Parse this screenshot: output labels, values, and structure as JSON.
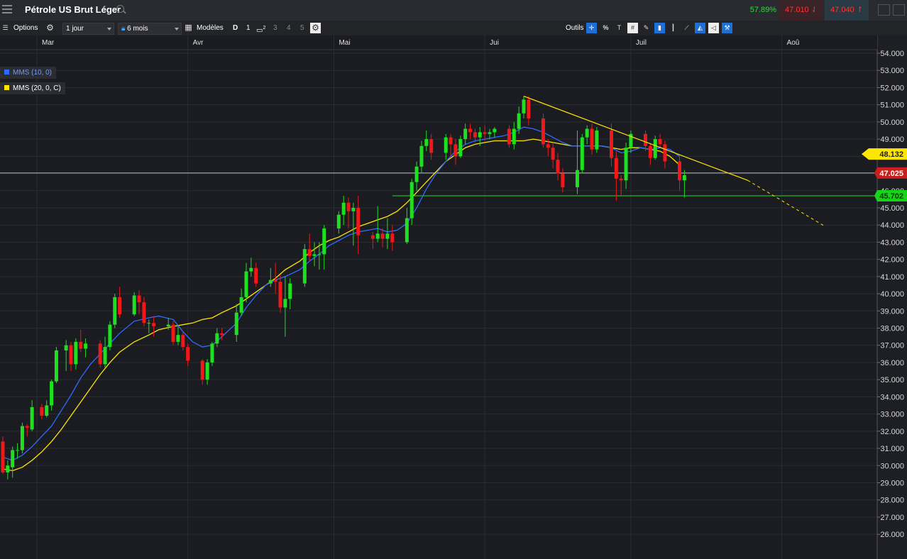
{
  "header": {
    "title": "Pétrole US Brut Léger",
    "change_pct": "57.89%",
    "sell_price": "47.010",
    "buy_price": "47.040"
  },
  "toolbar": {
    "options": "Options",
    "interval": "1 jour",
    "range": "6 mois",
    "models": "Modèles",
    "d": "D",
    "n1": "1",
    "n2": "2",
    "n3": "3",
    "n4": "4",
    "n5": "5",
    "tools": "Outils",
    "pct": "%"
  },
  "legend": {
    "ma10": "MMS (10, 0)",
    "ma20": "MMS (20, 0, C)",
    "ma10_color": "#2f6bff",
    "ma20_color": "#ffe600"
  },
  "chart_data": {
    "type": "candlestick",
    "months": [
      {
        "label": "Mar",
        "day": 0
      },
      {
        "label": "Avr",
        "day": 31
      },
      {
        "label": "Mai",
        "day": 61
      },
      {
        "label": "Jui",
        "day": 92
      },
      {
        "label": "Juil",
        "day": 122
      },
      {
        "label": "Aoû",
        "day": 153
      }
    ],
    "y_ticks": [
      "54.000",
      "53.000",
      "52.000",
      "51.000",
      "50.000",
      "49.000",
      "48.000",
      "47.000",
      "46.000",
      "45.000",
      "44.000",
      "43.000",
      "42.000",
      "41.000",
      "40.000",
      "39.000",
      "38.000",
      "37.000",
      "36.000",
      "35.000",
      "34.000",
      "33.000",
      "32.000",
      "31.000",
      "30.000",
      "29.000",
      "28.000",
      "27.000",
      "26.000"
    ],
    "ylim": [
      25.3,
      54.2
    ],
    "candles": [
      [
        -7,
        31.4,
        29.6,
        31.7,
        29.5
      ],
      [
        -6,
        29.6,
        30.0,
        30.3,
        29.2
      ],
      [
        -5,
        29.9,
        30.9,
        31.1,
        29.3
      ],
      [
        -4,
        30.9,
        30.9,
        31.3,
        30.4
      ],
      [
        -3,
        30.9,
        32.3,
        32.5,
        30.7
      ],
      [
        -2,
        32.3,
        32.2,
        32.4,
        31.7
      ],
      [
        -1,
        32.1,
        33.4,
        33.8,
        32.0
      ],
      [
        1,
        33.4,
        32.9,
        33.6,
        32.7
      ],
      [
        2,
        32.9,
        33.5,
        33.8,
        32.8
      ],
      [
        3,
        33.5,
        34.9,
        35.0,
        33.2
      ],
      [
        4,
        34.9,
        36.7,
        36.9,
        34.8
      ],
      [
        6,
        36.7,
        37.0,
        37.3,
        35.5
      ],
      [
        7,
        37.0,
        35.9,
        37.2,
        35.5
      ],
      [
        8,
        35.9,
        37.2,
        37.4,
        35.6
      ],
      [
        9,
        37.2,
        36.8,
        37.9,
        36.6
      ],
      [
        10,
        36.8,
        37.1,
        37.4,
        36.3
      ],
      [
        13,
        37.1,
        35.9,
        37.3,
        35.7
      ],
      [
        14,
        35.9,
        36.9,
        37.5,
        35.7
      ],
      [
        15,
        36.9,
        38.2,
        38.4,
        36.7
      ],
      [
        16,
        38.2,
        39.8,
        40.0,
        38.0
      ],
      [
        17,
        39.8,
        38.8,
        40.4,
        38.6
      ],
      [
        20,
        38.8,
        39.9,
        40.1,
        38.7
      ],
      [
        21,
        39.9,
        39.5,
        40.2,
        38.8
      ],
      [
        22,
        39.5,
        38.3,
        39.8,
        38.1
      ],
      [
        23,
        38.3,
        38.3,
        38.5,
        37.7
      ],
      [
        24,
        38.3,
        38.1,
        38.7,
        37.5
      ],
      [
        27,
        38.1,
        38.2,
        38.6,
        37.9
      ],
      [
        28,
        38.2,
        37.2,
        38.4,
        37.0
      ],
      [
        29,
        37.2,
        37.6,
        38.1,
        37.0
      ],
      [
        30,
        37.6,
        36.9,
        37.8,
        36.7
      ],
      [
        31,
        36.9,
        36.1,
        37.1,
        35.8
      ],
      [
        34,
        36.1,
        35.0,
        36.2,
        34.7
      ],
      [
        35,
        35.0,
        36.0,
        36.2,
        34.7
      ],
      [
        36,
        36.0,
        37.1,
        37.2,
        35.8
      ],
      [
        37,
        37.1,
        37.7,
        38.0,
        36.9
      ],
      [
        38,
        37.7,
        37.6,
        38.0,
        37.3
      ],
      [
        41,
        37.6,
        38.9,
        39.4,
        37.2
      ],
      [
        42,
        38.9,
        39.8,
        40.3,
        38.7
      ],
      [
        43,
        39.8,
        41.3,
        41.8,
        39.5
      ],
      [
        44,
        41.3,
        41.5,
        42.1,
        41.0
      ],
      [
        45,
        41.5,
        40.6,
        41.8,
        40.4
      ],
      [
        48,
        40.6,
        40.8,
        41.5,
        40.4
      ],
      [
        49,
        40.8,
        40.7,
        41.8,
        40.0
      ],
      [
        50,
        40.7,
        39.2,
        41.1,
        38.9
      ],
      [
        51,
        39.2,
        39.7,
        41.0,
        37.5
      ],
      [
        52,
        39.7,
        40.6,
        40.9,
        39.1
      ],
      [
        55,
        40.6,
        42.6,
        42.9,
        40.4
      ],
      [
        56,
        42.6,
        42.2,
        43.5,
        41.9
      ],
      [
        57,
        42.2,
        42.3,
        43.0,
        41.6
      ],
      [
        58,
        42.3,
        42.3,
        43.0,
        41.4
      ],
      [
        59,
        42.3,
        43.8,
        44.0,
        41.4
      ],
      [
        62,
        43.8,
        44.6,
        44.8,
        43.5
      ],
      [
        63,
        44.6,
        45.3,
        45.7,
        44.0
      ],
      [
        64,
        45.3,
        44.8,
        45.6,
        43.8
      ],
      [
        65,
        44.8,
        45.0,
        45.3,
        42.8
      ],
      [
        66,
        45.0,
        43.4,
        45.7,
        42.3
      ],
      [
        69,
        43.4,
        43.2,
        43.6,
        42.6
      ],
      [
        70,
        43.2,
        43.5,
        45.1,
        43.0
      ],
      [
        71,
        43.5,
        43.2,
        43.8,
        42.7
      ],
      [
        72,
        43.2,
        43.5,
        44.4,
        42.6
      ],
      [
        73,
        43.5,
        43.0,
        44.0,
        42.5
      ],
      [
        76,
        43.0,
        44.4,
        45.0,
        42.9
      ],
      [
        77,
        44.4,
        46.5,
        46.7,
        44.0
      ],
      [
        78,
        46.5,
        47.4,
        47.7,
        46.0
      ],
      [
        79,
        47.4,
        48.6,
        48.9,
        47.0
      ],
      [
        80,
        48.6,
        49.0,
        49.5,
        48.3
      ],
      [
        81,
        49.0,
        48.2,
        49.3,
        47.8
      ],
      [
        84,
        48.2,
        49.1,
        49.3,
        47.8
      ],
      [
        85,
        49.1,
        48.7,
        49.3,
        48.0
      ],
      [
        86,
        48.7,
        48.0,
        49.0,
        47.5
      ],
      [
        87,
        48.0,
        49.0,
        49.2,
        47.9
      ],
      [
        88,
        49.0,
        49.6,
        49.9,
        48.7
      ],
      [
        89,
        49.6,
        49.4,
        49.9,
        49.0
      ],
      [
        90,
        49.4,
        49.1,
        49.6,
        48.8
      ],
      [
        91,
        49.1,
        49.4,
        49.7,
        48.6
      ],
      [
        92,
        49.4,
        49.3,
        49.8,
        48.9
      ],
      [
        93,
        49.3,
        49.4,
        49.6,
        49.0
      ],
      [
        94,
        49.4,
        49.6,
        49.7,
        49.1
      ],
      [
        97,
        49.6,
        48.7,
        49.8,
        48.5
      ],
      [
        98,
        48.7,
        49.6,
        50.0,
        48.4
      ],
      [
        99,
        49.6,
        50.5,
        50.9,
        49.3
      ],
      [
        100,
        50.5,
        51.3,
        51.5,
        50.2
      ],
      [
        101,
        51.3,
        50.2,
        51.5,
        49.8
      ],
      [
        104,
        50.2,
        48.7,
        50.5,
        48.5
      ],
      [
        105,
        48.7,
        48.5,
        49.0,
        48.0
      ],
      [
        106,
        48.5,
        47.8,
        48.8,
        47.3
      ],
      [
        107,
        47.8,
        47.0,
        48.2,
        46.6
      ],
      [
        108,
        47.0,
        46.2,
        47.3,
        45.9
      ],
      [
        111,
        46.2,
        47.2,
        49.5,
        45.8
      ],
      [
        112,
        47.2,
        49.1,
        49.3,
        47.0
      ],
      [
        113,
        49.1,
        49.6,
        49.8,
        48.7
      ],
      [
        114,
        49.6,
        48.4,
        49.9,
        48.1
      ],
      [
        115,
        48.4,
        49.5,
        49.7,
        48.2
      ],
      [
        118,
        49.5,
        47.9,
        49.9,
        47.4
      ],
      [
        119,
        47.9,
        46.7,
        48.3,
        45.4
      ],
      [
        120,
        46.7,
        46.6,
        46.9,
        45.7
      ],
      [
        121,
        46.6,
        48.5,
        48.8,
        46.1
      ],
      [
        122,
        48.5,
        49.3,
        49.5,
        48.2
      ],
      [
        125,
        49.3,
        48.6,
        49.5,
        48.3
      ],
      [
        126,
        48.6,
        47.9,
        48.8,
        47.5
      ],
      [
        127,
        47.9,
        49.0,
        49.2,
        47.8
      ],
      [
        128,
        49.0,
        48.7,
        49.3,
        48.5
      ],
      [
        129,
        48.7,
        47.7,
        48.9,
        47.3
      ],
      [
        132,
        47.7,
        46.6,
        48.0,
        46.0
      ],
      [
        133,
        46.6,
        46.9,
        47.2,
        45.6
      ]
    ],
    "ma10": [
      [
        -7,
        30.5
      ],
      [
        -5,
        30.3
      ],
      [
        -3,
        30.6
      ],
      [
        -1,
        31.1
      ],
      [
        1,
        31.7
      ],
      [
        3,
        32.3
      ],
      [
        5,
        33.2
      ],
      [
        7,
        34.1
      ],
      [
        9,
        35.1
      ],
      [
        11,
        35.9
      ],
      [
        13,
        36.5
      ],
      [
        15,
        37.1
      ],
      [
        17,
        37.7
      ],
      [
        20,
        38.4
      ],
      [
        23,
        38.6
      ],
      [
        25,
        38.7
      ],
      [
        28,
        38.5
      ],
      [
        30,
        37.8
      ],
      [
        32,
        37.2
      ],
      [
        34,
        36.9
      ],
      [
        36,
        37.0
      ],
      [
        38,
        37.5
      ],
      [
        41,
        38.3
      ],
      [
        43,
        39.2
      ],
      [
        45,
        39.9
      ],
      [
        47,
        40.5
      ],
      [
        49,
        40.8
      ],
      [
        51,
        41.0
      ],
      [
        54,
        41.4
      ],
      [
        56,
        41.9
      ],
      [
        58,
        42.3
      ],
      [
        60,
        42.8
      ],
      [
        62,
        43.1
      ],
      [
        64,
        43.4
      ],
      [
        66,
        43.6
      ],
      [
        68,
        43.7
      ],
      [
        70,
        43.8
      ],
      [
        72,
        43.6
      ],
      [
        74,
        43.7
      ],
      [
        76,
        44.1
      ],
      [
        78,
        45.0
      ],
      [
        80,
        46.1
      ],
      [
        82,
        47.0
      ],
      [
        84,
        47.7
      ],
      [
        86,
        48.3
      ],
      [
        88,
        48.7
      ],
      [
        90,
        48.9
      ],
      [
        92,
        49.0
      ],
      [
        94,
        49.1
      ],
      [
        96,
        49.2
      ],
      [
        98,
        49.4
      ],
      [
        100,
        49.7
      ],
      [
        102,
        49.6
      ],
      [
        104,
        49.4
      ],
      [
        106,
        49.1
      ],
      [
        108,
        48.8
      ],
      [
        110,
        48.6
      ],
      [
        112,
        48.6
      ],
      [
        114,
        48.6
      ],
      [
        116,
        48.6
      ],
      [
        118,
        48.5
      ],
      [
        120,
        48.2
      ],
      [
        122,
        48.3
      ],
      [
        124,
        48.5
      ],
      [
        126,
        48.4
      ],
      [
        128,
        48.5
      ],
      [
        130,
        48.4
      ],
      [
        132,
        48.0
      ]
    ],
    "ma20": [
      [
        -7,
        29.8
      ],
      [
        -5,
        29.7
      ],
      [
        -3,
        29.9
      ],
      [
        -1,
        30.3
      ],
      [
        1,
        30.8
      ],
      [
        3,
        31.4
      ],
      [
        5,
        32.1
      ],
      [
        7,
        32.9
      ],
      [
        9,
        33.7
      ],
      [
        11,
        34.5
      ],
      [
        13,
        35.3
      ],
      [
        15,
        36.0
      ],
      [
        17,
        36.6
      ],
      [
        20,
        37.2
      ],
      [
        23,
        37.6
      ],
      [
        25,
        37.9
      ],
      [
        28,
        38.1
      ],
      [
        30,
        38.2
      ],
      [
        32,
        38.3
      ],
      [
        34,
        38.5
      ],
      [
        36,
        38.6
      ],
      [
        38,
        38.9
      ],
      [
        41,
        39.3
      ],
      [
        43,
        39.7
      ],
      [
        45,
        40.1
      ],
      [
        47,
        40.5
      ],
      [
        49,
        40.9
      ],
      [
        51,
        41.4
      ],
      [
        54,
        41.9
      ],
      [
        56,
        42.4
      ],
      [
        58,
        42.8
      ],
      [
        60,
        43.1
      ],
      [
        62,
        43.3
      ],
      [
        64,
        43.6
      ],
      [
        66,
        43.9
      ],
      [
        68,
        44.1
      ],
      [
        70,
        44.3
      ],
      [
        72,
        44.5
      ],
      [
        74,
        44.8
      ],
      [
        76,
        45.3
      ],
      [
        78,
        45.9
      ],
      [
        80,
        46.5
      ],
      [
        82,
        47.1
      ],
      [
        84,
        47.7
      ],
      [
        86,
        48.1
      ],
      [
        88,
        48.5
      ],
      [
        90,
        48.7
      ],
      [
        92,
        48.8
      ],
      [
        94,
        48.9
      ],
      [
        96,
        48.9
      ],
      [
        98,
        48.9
      ],
      [
        100,
        48.9
      ],
      [
        102,
        49.0
      ],
      [
        104,
        48.9
      ],
      [
        106,
        48.8
      ],
      [
        108,
        48.7
      ],
      [
        110,
        48.6
      ],
      [
        112,
        48.6
      ],
      [
        114,
        48.6
      ],
      [
        116,
        48.6
      ],
      [
        118,
        48.5
      ],
      [
        120,
        48.4
      ],
      [
        122,
        48.5
      ],
      [
        124,
        48.5
      ],
      [
        126,
        48.4
      ],
      [
        128,
        48.3
      ],
      [
        130,
        48.0
      ],
      [
        132,
        47.5
      ]
    ],
    "trendline": {
      "from": [
        100,
        51.5
      ],
      "to": [
        146,
        46.6
      ],
      "dashed_to": [
        162,
        43.9
      ]
    },
    "support": {
      "day_from": 73,
      "day_to": 200,
      "value": 45.702
    },
    "price_line": 47.025,
    "labels": {
      "trend": "48.132",
      "trend_value": 48.132,
      "price": "47.025",
      "price_value": 47.025,
      "support": "45.702",
      "support_value": 45.702
    },
    "partial_tick": "47.XXX"
  }
}
